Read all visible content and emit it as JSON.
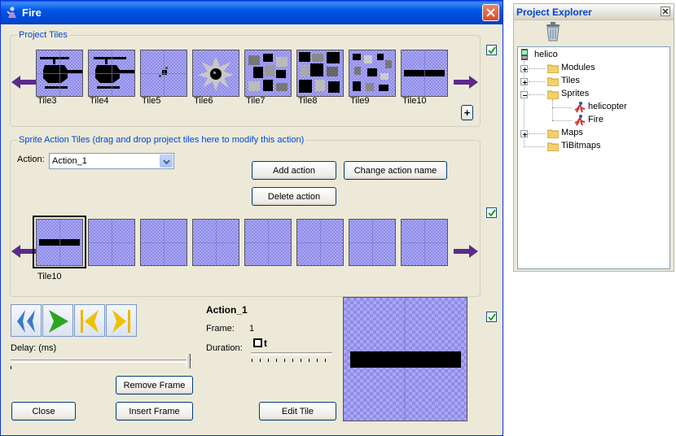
{
  "window": {
    "title": "Fire"
  },
  "project_tiles": {
    "label": "Project Tiles",
    "tiles": [
      "Tile3",
      "Tile4",
      "Tile5",
      "Tile6",
      "Tile7",
      "Tile8",
      "Tile9",
      "Tile10"
    ],
    "add_label": "+"
  },
  "sprite_action_tiles": {
    "label": "Sprite Action Tiles (drag and drop project tiles here to modify this action)",
    "action_label": "Action:",
    "action_value": "Action_1",
    "add_action": "Add action",
    "change_action_name": "Change action name",
    "delete_action": "Delete action",
    "frame_tile_label": "Tile10"
  },
  "playback": {
    "delay_label": "Delay: (ms)",
    "remove_frame": "Remove Frame",
    "insert_frame": "Insert Frame",
    "close": "Close",
    "edit_tile": "Edit Tile"
  },
  "info": {
    "action_name": "Action_1",
    "frame_label": "Frame:",
    "frame_value": "1",
    "duration_label": "Duration:",
    "duration_value": "t"
  },
  "explorer": {
    "title": "Project Explorer",
    "root": "helico",
    "items": {
      "modules": "Modules",
      "tiles": "Tiles",
      "sprites": "Sprites",
      "sprite_helicopter": "helicopter",
      "sprite_fire": "Fire",
      "maps": "Maps",
      "tibitmaps": "TiBitmaps"
    }
  },
  "colors": {
    "title_blue": "#0054e3",
    "group_label": "#0046d5",
    "tile_bg": "#a9a7f4",
    "arrow_purple": "#5b2a8c",
    "play_green": "#2aa61c"
  }
}
